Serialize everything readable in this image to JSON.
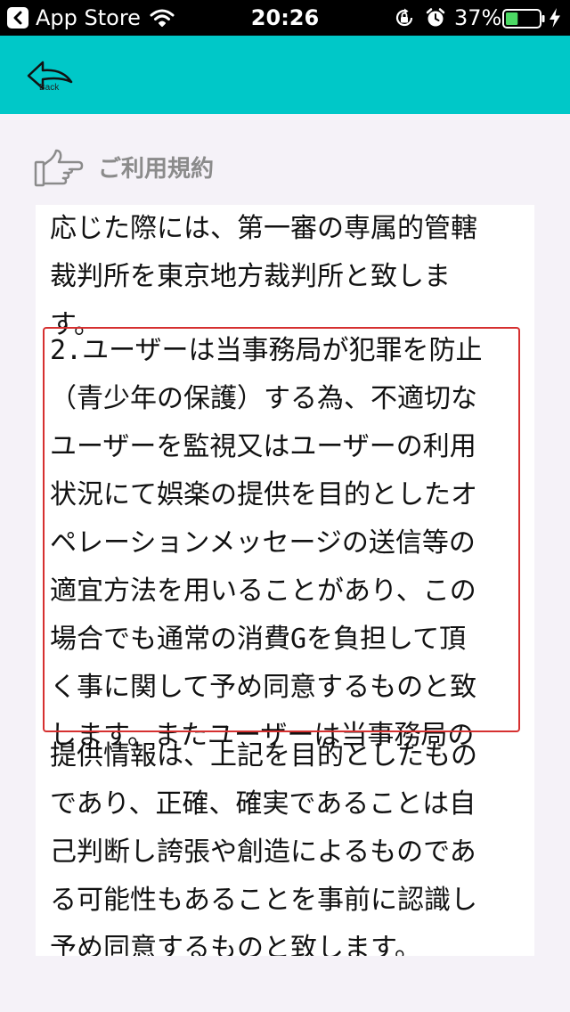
{
  "status_bar": {
    "back_app": "App Store",
    "time": "20:26",
    "battery_percent": "37%",
    "battery_level": 0.37,
    "icons": [
      "back-arrow-icon",
      "wifi-icon",
      "rotation-lock-icon",
      "alarm-icon",
      "battery-icon",
      "charging-bolt-icon"
    ]
  },
  "nav": {
    "back_label": "Back",
    "background_color": "#00c8c8"
  },
  "section": {
    "icon": "pointing-hand-icon",
    "title": "ご利用規約"
  },
  "terms": {
    "before": "応じた際には、第一審の専属的管轄\n裁判所を東京地方裁判所と致しま\nす。",
    "highlighted": "2.ユーザーは当事務局が犯罪を防止\n（青少年の保護）する為、不適切な\nユーザーを監視又はユーザーの利用\n状況にて娯楽の提供を目的としたオ\nペレーションメッセージの送信等の\n適宜方法を用いることがあり、この\n場合でも通常の消費Gを負担して頂\nく事に関して予め同意するものと致\nします。またユーザーは当事務局の",
    "after": "提供情報は、上記を目的としたもの\nであり、正確、確実であることは自\n己判断し誇張や創造によるものであ\nる可能性もあることを事前に認識し\n予め同意するものと致します。",
    "highlight_color": "#d63030"
  }
}
